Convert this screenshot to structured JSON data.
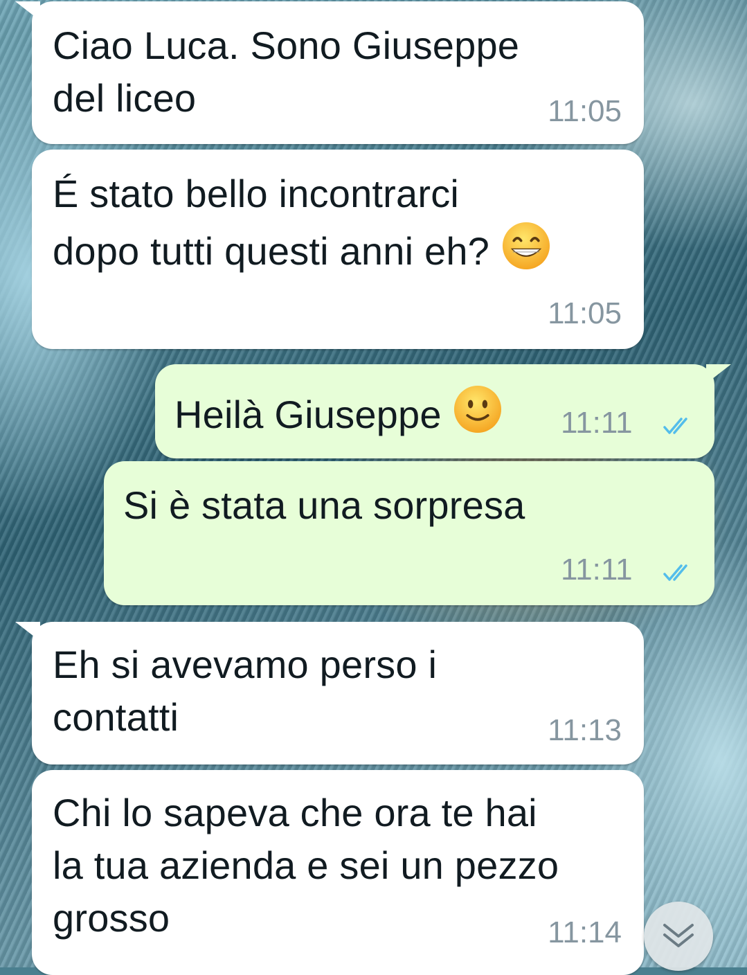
{
  "colors": {
    "incoming_bubble": "#ffffff",
    "outgoing_bubble": "#e7fed8",
    "text": "#111b21",
    "timestamp": "#8696a0",
    "read_ticks": "#53bdeb"
  },
  "messages": [
    {
      "direction": "incoming",
      "text": "Ciao Luca. Sono Giuseppe\ndel liceo",
      "time": "11:05"
    },
    {
      "direction": "incoming",
      "text": "É stato bello incontrarci\ndopo tutti questi anni eh?",
      "emoji": "grinning-face-emoji",
      "time": "11:05"
    },
    {
      "direction": "outgoing",
      "text": "Heilà Giuseppe",
      "emoji": "slightly-smiling-face-emoji",
      "time": "11:11",
      "status": "read"
    },
    {
      "direction": "outgoing",
      "text": "Si è stata una sorpresa",
      "time": "11:11",
      "status": "read"
    },
    {
      "direction": "incoming",
      "text": "Eh si avevamo perso i\ncontatti",
      "time": "11:13"
    },
    {
      "direction": "incoming",
      "text": "Chi lo sapeva che ora te hai\nla tua azienda e sei un pezzo\ngrosso",
      "time": "11:14"
    }
  ],
  "scroll_button": {
    "icon": "double-chevron-down-icon"
  }
}
